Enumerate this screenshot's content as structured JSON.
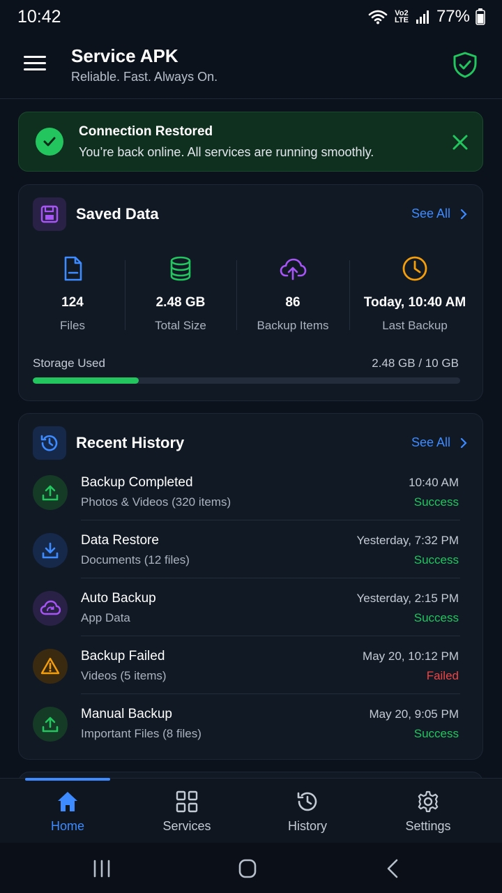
{
  "status_bar": {
    "time": "10:42",
    "network_label": "Vo2 LTE",
    "battery": "77%"
  },
  "app": {
    "title": "Service APK",
    "subtitle": "Reliable. Fast. Always On."
  },
  "banner": {
    "title": "Connection Restored",
    "message": "You’re back online. All services are running smoothly."
  },
  "saved_data": {
    "title": "Saved Data",
    "see_all": "See All",
    "stats": [
      {
        "value": "124",
        "label": "Files",
        "icon": "file-icon",
        "color": "#3d8bff"
      },
      {
        "value": "2.48 GB",
        "label": "Total Size",
        "icon": "database-icon",
        "color": "#22c55e"
      },
      {
        "value": "86",
        "label": "Backup Items",
        "icon": "cloud-upload-icon",
        "color": "#a855f7"
      },
      {
        "value": "Today, 10:40 AM",
        "label": "Last Backup",
        "icon": "clock-icon",
        "color": "#f59e0b"
      }
    ],
    "storage": {
      "label": "Storage Used",
      "value": "2.48 GB / 10 GB",
      "fraction": 0.248
    }
  },
  "history": {
    "title": "Recent History",
    "see_all": "See All",
    "items": [
      {
        "title": "Backup Completed",
        "subtitle": "Photos & Videos (320 items)",
        "time": "10:40 AM",
        "status": "Success",
        "icon": "upload-icon"
      },
      {
        "title": "Data Restore",
        "subtitle": "Documents (12 files)",
        "time": "Yesterday, 7:32 PM",
        "status": "Success",
        "icon": "download-icon"
      },
      {
        "title": "Auto Backup",
        "subtitle": "App Data",
        "time": "Yesterday, 2:15 PM",
        "status": "Success",
        "icon": "cloud-refresh-icon"
      },
      {
        "title": "Backup Failed",
        "subtitle": "Videos (5 items)",
        "time": "May 20, 10:12 PM",
        "status": "Failed",
        "icon": "warning-icon"
      },
      {
        "title": "Manual Backup",
        "subtitle": "Important Files (8 files)",
        "time": "May 20, 9:05 PM",
        "status": "Success",
        "icon": "upload-icon"
      }
    ]
  },
  "nav": {
    "home": "Home",
    "services": "Services",
    "history": "History",
    "settings": "Settings",
    "active": "Home"
  },
  "colors": {
    "accent": "#3d8bff",
    "success": "#22c55e",
    "failed": "#ef4444",
    "warning": "#f59e0b",
    "purple": "#a855f7",
    "background": "#0c121c",
    "card": "#111925"
  }
}
